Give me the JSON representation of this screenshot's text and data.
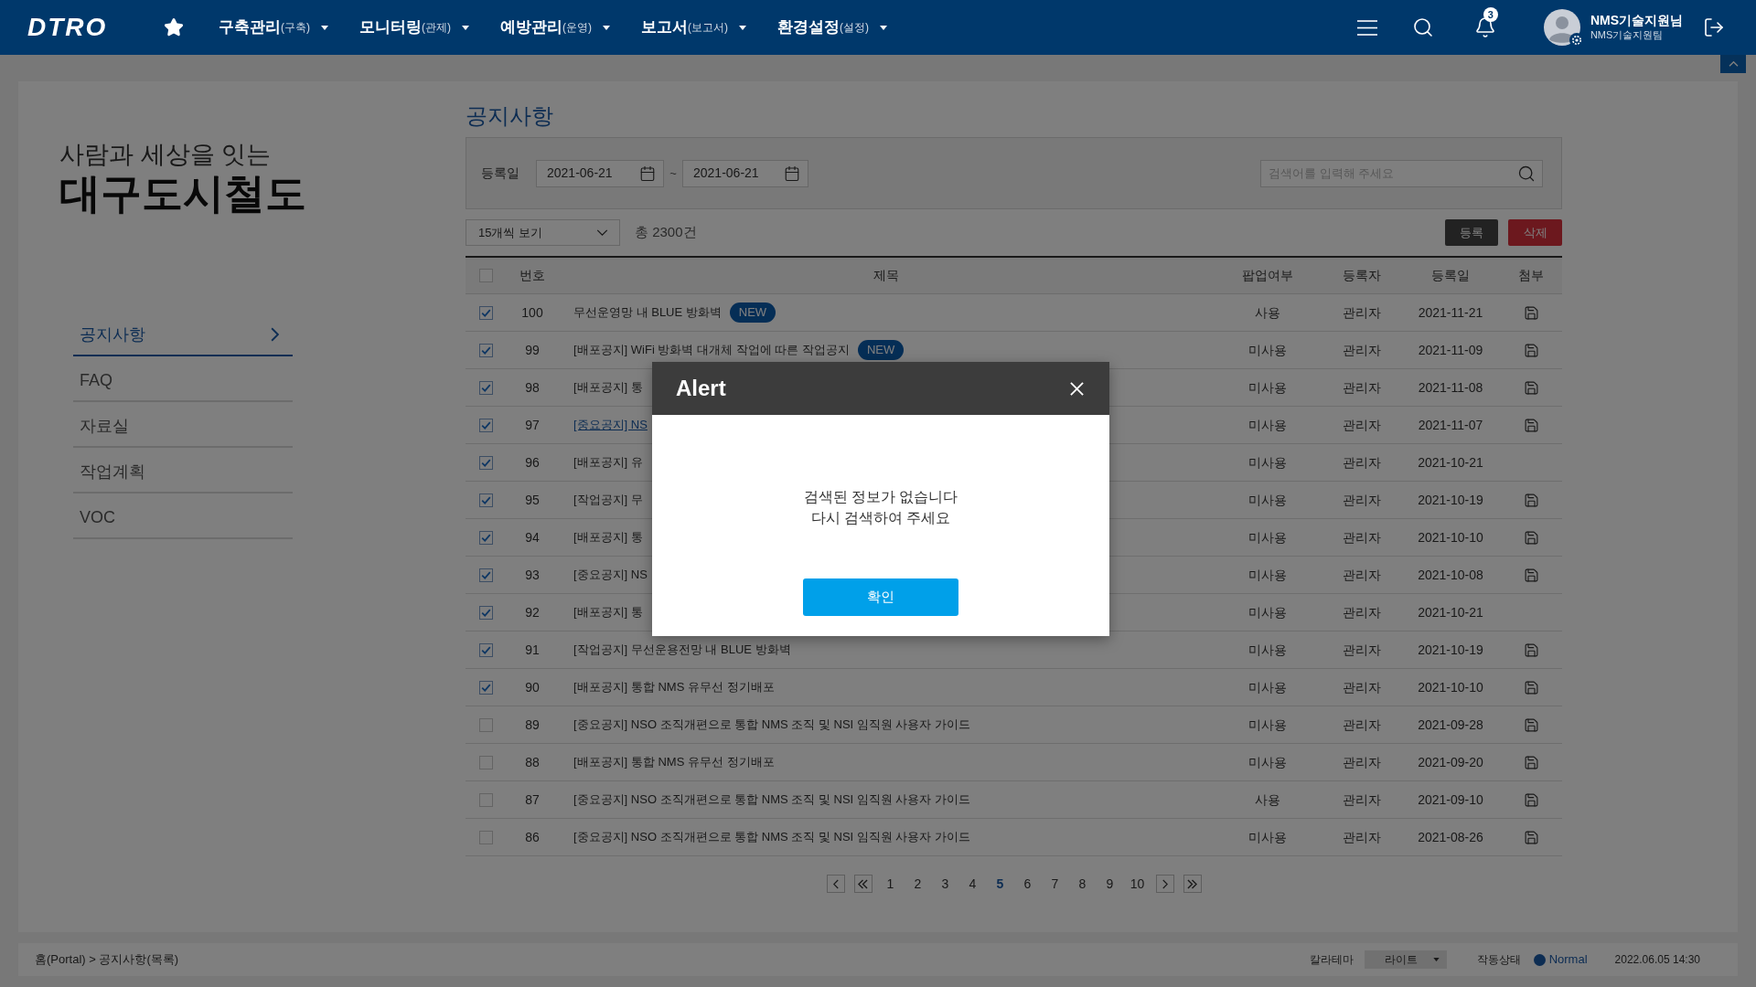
{
  "header": {
    "logo": "DTRO",
    "menu": [
      {
        "label": "구축관리",
        "sub": "(구축)"
      },
      {
        "label": "모니터링",
        "sub": "(관제)"
      },
      {
        "label": "예방관리",
        "sub": "(운영)"
      },
      {
        "label": "보고서",
        "sub": "(보고서)"
      },
      {
        "label": "환경설정",
        "sub": "(설정)"
      }
    ],
    "notification_count": "3",
    "user": {
      "name": "NMS기술지원님",
      "team": "NMS기술지원팀"
    }
  },
  "sidebar": {
    "tagline": "사람과 세상을 잇는",
    "brand": "대구도시철도",
    "items": [
      {
        "label": "공지사항",
        "selected": true
      },
      {
        "label": "FAQ",
        "selected": false
      },
      {
        "label": "자료실",
        "selected": false
      },
      {
        "label": "작업계획",
        "selected": false
      },
      {
        "label": "VOC",
        "selected": false
      }
    ]
  },
  "page_title": "공지사항",
  "filter": {
    "date_label": "등록일",
    "date_from": "2021-06-21",
    "separator": "~",
    "date_to": "2021-06-21",
    "search_placeholder": "검색어를 입력해 주세요"
  },
  "toolbar": {
    "page_size": "15개씩 보기",
    "total": "총 2300건",
    "buttons": [
      {
        "label": "등록",
        "kind": "primary"
      },
      {
        "label": "삭제",
        "kind": "danger"
      }
    ]
  },
  "table": {
    "header_checked": false,
    "columns": [
      "번호",
      "제목",
      "팝업여부",
      "등록자",
      "등록일",
      "첨부"
    ],
    "rows": [
      {
        "checked": true,
        "number": "100",
        "title": "무선운영망 내 BLUE 방화벽",
        "badge": "NEW",
        "link": false,
        "popup": "사용",
        "author": "관리자",
        "date": "2021-11-21",
        "attachment": true
      },
      {
        "checked": true,
        "number": "99",
        "title": "[배포공지] WiFi 방화벽 대개체 작업에 따른 작업공지",
        "badge": "NEW",
        "link": false,
        "popup": "미사용",
        "author": "관리자",
        "date": "2021-11-09",
        "attachment": true
      },
      {
        "checked": true,
        "number": "98",
        "title": "[배포공지] 통",
        "link": false,
        "popup": "미사용",
        "author": "관리자",
        "date": "2021-11-08",
        "attachment": true
      },
      {
        "checked": true,
        "number": "97",
        "title": "[중요공지] NS",
        "link": true,
        "popup": "미사용",
        "author": "관리자",
        "date": "2021-11-07",
        "attachment": true
      },
      {
        "checked": true,
        "number": "96",
        "title": "[배포공지] 유",
        "link": false,
        "popup": "미사용",
        "author": "관리자",
        "date": "2021-10-21",
        "attachment": false
      },
      {
        "checked": true,
        "number": "95",
        "title": "[작업공지] 무",
        "link": false,
        "popup": "미사용",
        "author": "관리자",
        "date": "2021-10-19",
        "attachment": true
      },
      {
        "checked": true,
        "number": "94",
        "title": "[배포공지] 통",
        "link": false,
        "popup": "미사용",
        "author": "관리자",
        "date": "2021-10-10",
        "attachment": true
      },
      {
        "checked": true,
        "number": "93",
        "title": "[중요공지] NS",
        "link": false,
        "popup": "미사용",
        "author": "관리자",
        "date": "2021-10-08",
        "attachment": true
      },
      {
        "checked": true,
        "number": "92",
        "title": "[배포공지] 통",
        "link": false,
        "popup": "미사용",
        "author": "관리자",
        "date": "2021-10-21",
        "attachment": false
      },
      {
        "checked": true,
        "number": "91",
        "title": "[작업공지] 무선운용전망 내 BLUE 방화벽",
        "link": false,
        "popup": "미사용",
        "author": "관리자",
        "date": "2021-10-19",
        "attachment": true
      },
      {
        "checked": true,
        "number": "90",
        "title": "[배포공지] 통합 NMS 유무선 정기배포",
        "link": false,
        "popup": "미사용",
        "author": "관리자",
        "date": "2021-10-10",
        "attachment": true
      },
      {
        "checked": false,
        "number": "89",
        "title": "[중요공지] NSO 조직개편으로 통합 NMS 조직 및 NSI 임직원 사용자 가이드",
        "link": false,
        "popup": "미사용",
        "author": "관리자",
        "date": "2021-09-28",
        "attachment": true
      },
      {
        "checked": false,
        "number": "88",
        "title": "[배포공지] 통합 NMS 유무선 정기배포",
        "link": false,
        "popup": "미사용",
        "author": "관리자",
        "date": "2021-09-20",
        "attachment": true
      },
      {
        "checked": false,
        "number": "87",
        "title": "[중요공지] NSO 조직개편으로 통합 NMS 조직 및 NSI 임직원 사용자 가이드",
        "link": false,
        "popup": "사용",
        "author": "관리자",
        "date": "2021-09-10",
        "attachment": true
      },
      {
        "checked": false,
        "number": "86",
        "title": "[중요공지] NSO 조직개편으로 통합 NMS 조직 및 NSI 임직원 사용자 가이드",
        "link": false,
        "popup": "미사용",
        "author": "관리자",
        "date": "2021-08-26",
        "attachment": true
      }
    ]
  },
  "pagination": {
    "pages": [
      {
        "label": "1",
        "selected": false
      },
      {
        "label": "2",
        "selected": false
      },
      {
        "label": "3",
        "selected": false
      },
      {
        "label": "4",
        "selected": false
      },
      {
        "label": "5",
        "selected": true
      },
      {
        "label": "6",
        "selected": false
      },
      {
        "label": "7",
        "selected": false
      },
      {
        "label": "8",
        "selected": false
      },
      {
        "label": "9",
        "selected": false
      },
      {
        "label": "10",
        "selected": false
      }
    ]
  },
  "status_bar": {
    "breadcrumb": "홈(Portal) > 공지사항(목록)",
    "theme_label": "칼라테마",
    "theme_value": "라이트",
    "status_label": "작동상태",
    "status": "Normal",
    "timestamp": "2022.06.05 14:30"
  },
  "alert": {
    "title": "Alert",
    "message": [
      "검색된 정보가 없습니다",
      "다시 검색하여 주세요"
    ],
    "button": "확인"
  }
}
